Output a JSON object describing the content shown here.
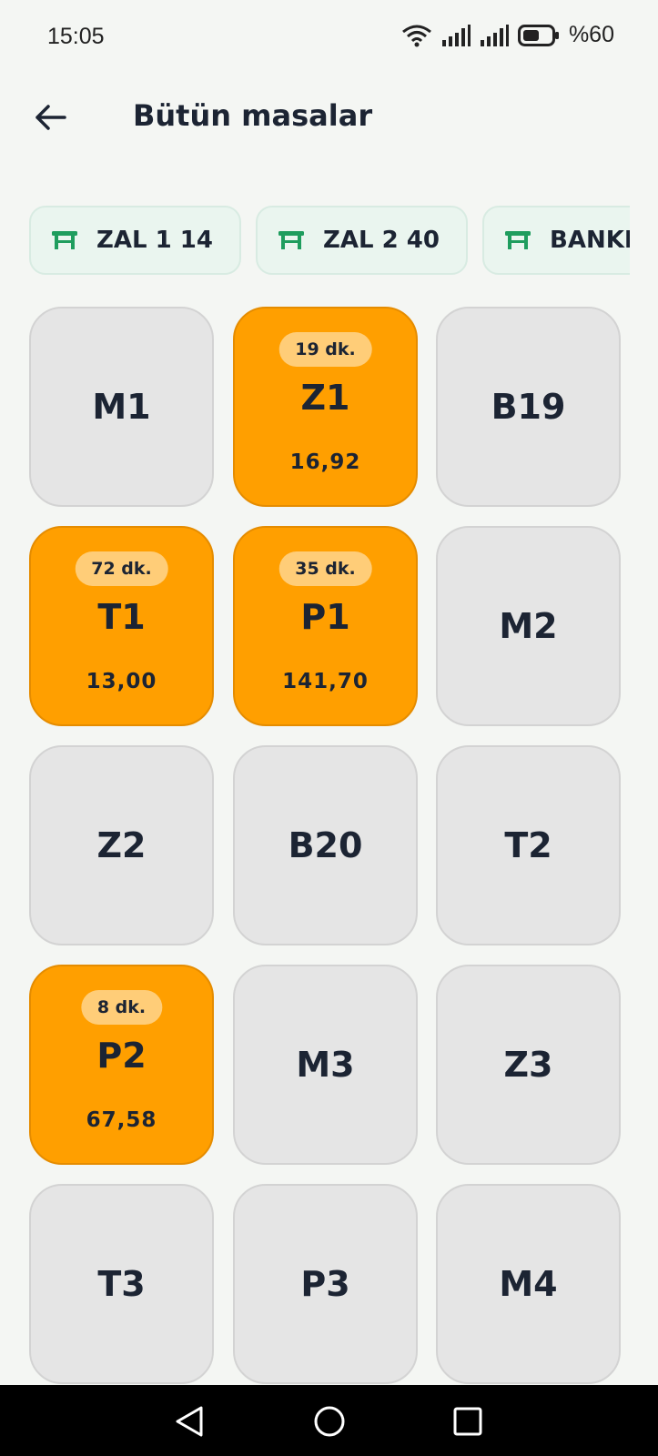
{
  "status_bar": {
    "time": "15:05",
    "battery": "%60"
  },
  "header": {
    "title": "Bütün masalar"
  },
  "chips": [
    {
      "label": "ZAL 1 14",
      "icon": "table-icon"
    },
    {
      "label": "ZAL 2 40",
      "icon": "table-icon"
    },
    {
      "label": "BANKET",
      "icon": "table-icon"
    }
  ],
  "tables": [
    {
      "name": "M1"
    },
    {
      "name": "Z1",
      "time": "19 dk.",
      "amount": "16,92"
    },
    {
      "name": "B19"
    },
    {
      "name": "T1",
      "time": "72 dk.",
      "amount": "13,00"
    },
    {
      "name": "P1",
      "time": "35 dk.",
      "amount": "141,70"
    },
    {
      "name": "M2"
    },
    {
      "name": "Z2"
    },
    {
      "name": "B20"
    },
    {
      "name": "T2"
    },
    {
      "name": "P2",
      "time": "8 dk.",
      "amount": "67,58"
    },
    {
      "name": "M3"
    },
    {
      "name": "Z3"
    },
    {
      "name": "T3"
    },
    {
      "name": "P3"
    },
    {
      "name": "M4"
    }
  ],
  "colors": {
    "occupied": "#ff9f00",
    "free": "#e5e5e5",
    "badge": "#ffcd78",
    "chip_bg": "#eaf5ef",
    "chip_icon": "#1f9d5e"
  }
}
